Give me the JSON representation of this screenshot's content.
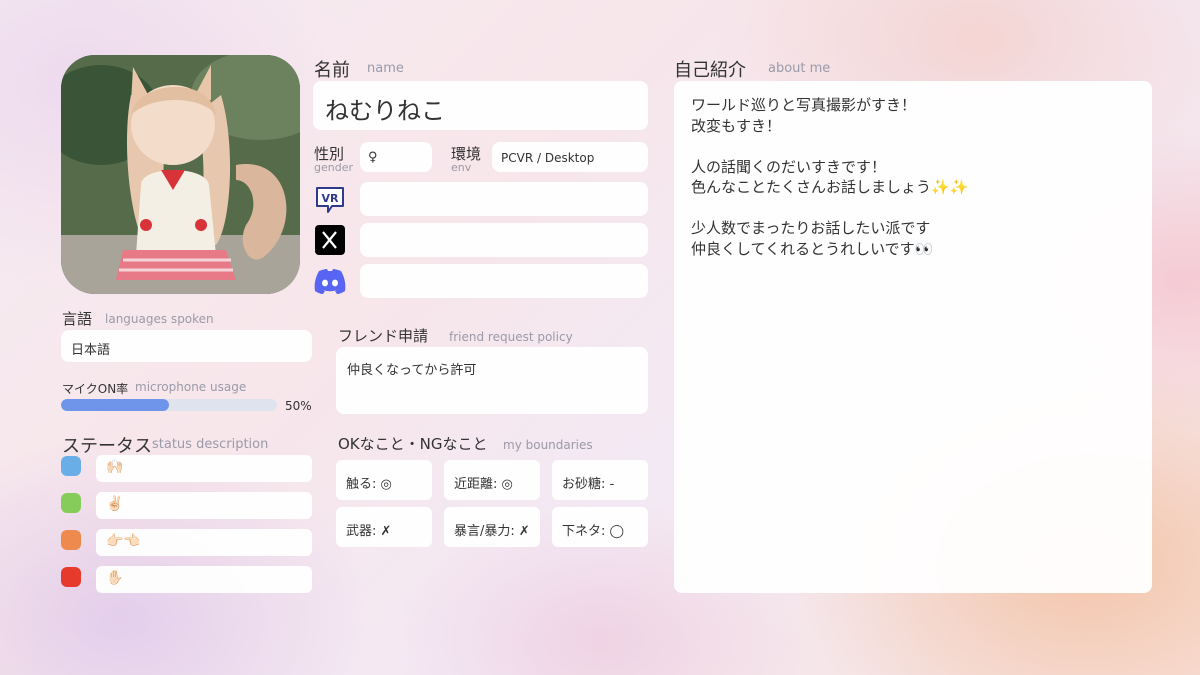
{
  "avatar": {
    "icon": "anime-catgirl-avatar-photo"
  },
  "name": {
    "label_jp": "名前",
    "label_en": "name",
    "value": "ねむりねこ"
  },
  "gender": {
    "label_jp": "性別",
    "label_en": "gender",
    "value": "♀"
  },
  "env": {
    "label_jp": "環境",
    "label_en": "env",
    "value": "PCVR / Desktop"
  },
  "social": [
    {
      "icon": "vrchat-icon",
      "value": ""
    },
    {
      "icon": "x-icon",
      "value": ""
    },
    {
      "icon": "discord-icon",
      "value": ""
    }
  ],
  "languages": {
    "label_jp": "言語",
    "label_en": "languages spoken",
    "value": "日本語"
  },
  "mic": {
    "label_jp": "マイクON率",
    "label_en": "microphone usage",
    "percent_text": "50%",
    "percent": 50,
    "color": "#6f95ea"
  },
  "status": {
    "label_jp": "ステータス",
    "label_en": "status description",
    "items": [
      {
        "color": "#6aaee8",
        "text": "🙌🏻"
      },
      {
        "color": "#86cc5a",
        "text": "✌🏻"
      },
      {
        "color": "#ee8a4e",
        "text": "👉🏻👈🏻"
      },
      {
        "color": "#e53a2c",
        "text": "✋🏻"
      }
    ]
  },
  "friend": {
    "label_jp": "フレンド申請",
    "label_en": "friend request policy",
    "value": "仲良くなってから許可"
  },
  "boundaries": {
    "label_jp": "OKなこと・NGなこと",
    "label_en": "my boundaries",
    "items": [
      "触る: ◎",
      "近距離: ◎",
      "お砂糖: -",
      "武器: ✗",
      "暴言/暴力: ✗",
      "下ネタ: ◯"
    ]
  },
  "about": {
    "label_jp": "自己紹介",
    "label_en": "about me",
    "lines": [
      "ワールド巡りと写真撮影がすき！",
      "改変もすき！",
      "",
      "人の話聞くのだいすきです！",
      "色んなことたくさんお話しましょう✨✨",
      "",
      "少人数でまったりお話したい派です",
      "仲良くしてくれるとうれしいです👀"
    ]
  }
}
